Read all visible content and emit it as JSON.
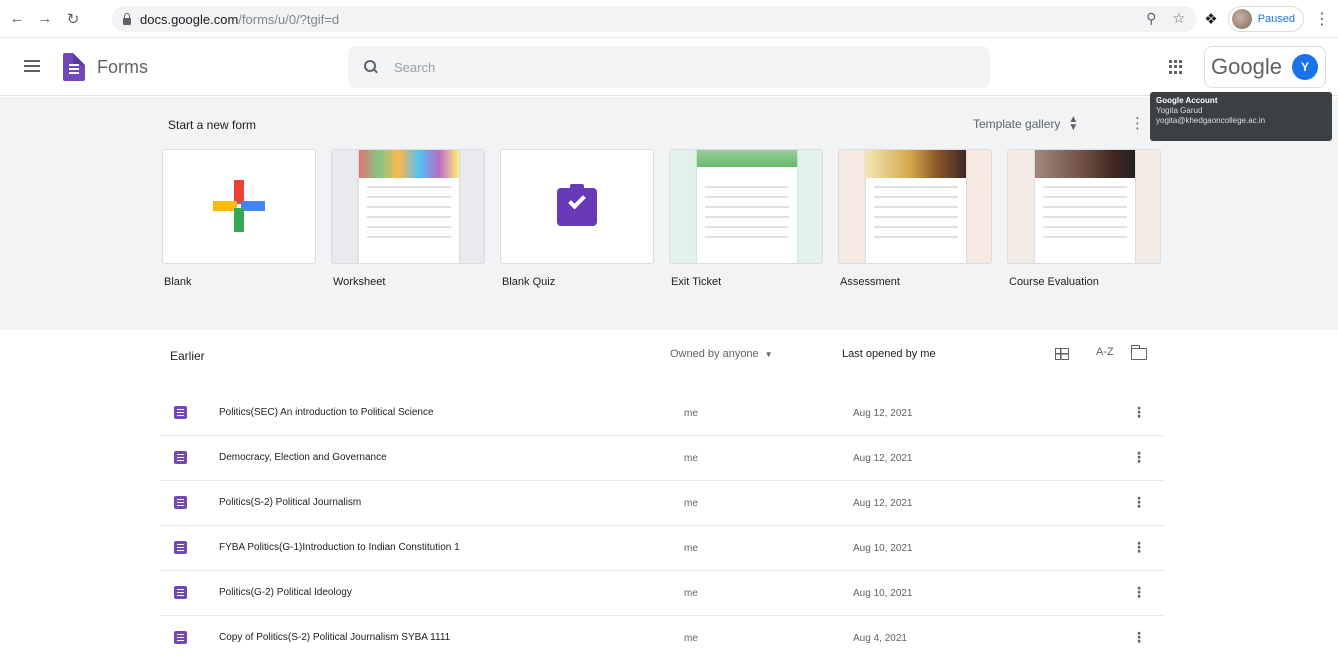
{
  "browser": {
    "url_host": "docs.google.com",
    "url_path": "/forms/u/0/?tgif=d",
    "profile_status": "Paused",
    "back_icon": "arrow-left",
    "forward_icon": "arrow-right",
    "reload_icon": "reload"
  },
  "header": {
    "app_name": "Forms",
    "search_placeholder": "Search",
    "google_label": "Google",
    "avatar_letter": "Y",
    "brand_color": "#7248b9"
  },
  "tooltip": {
    "title": "Google Account",
    "name": "Yogita Garud",
    "email": "yogita@khedgaoncollege.ac.in"
  },
  "templates": {
    "section_label": "Start a new form",
    "gallery_label": "Template gallery",
    "items": [
      {
        "name": "Blank"
      },
      {
        "name": "Worksheet"
      },
      {
        "name": "Blank Quiz"
      },
      {
        "name": "Exit Ticket"
      },
      {
        "name": "Assessment"
      },
      {
        "name": "Course Evaluation"
      }
    ]
  },
  "list": {
    "section_label": "Earlier",
    "owner_filter": "Owned by anyone",
    "sort_label": "Last opened by me",
    "sort_icon": "A-Z",
    "rows": [
      {
        "title": "Politics(SEC) An introduction to Political Science",
        "owner": "me",
        "date": "Aug 12, 2021"
      },
      {
        "title": "Democracy, Election and Governance",
        "owner": "me",
        "date": "Aug 12, 2021"
      },
      {
        "title": "Politics(S-2) Political Journalism",
        "owner": "me",
        "date": "Aug 12, 2021"
      },
      {
        "title": "FYBA Politics(G-1)Introduction to Indian Constitution 1",
        "owner": "me",
        "date": "Aug 10, 2021"
      },
      {
        "title": "Politics(G-2) Political Ideology",
        "owner": "me",
        "date": "Aug 10, 2021"
      },
      {
        "title": "Copy of Politics(S-2) Political Journalism SYBA 1111",
        "owner": "me",
        "date": "Aug 4, 2021"
      }
    ]
  }
}
